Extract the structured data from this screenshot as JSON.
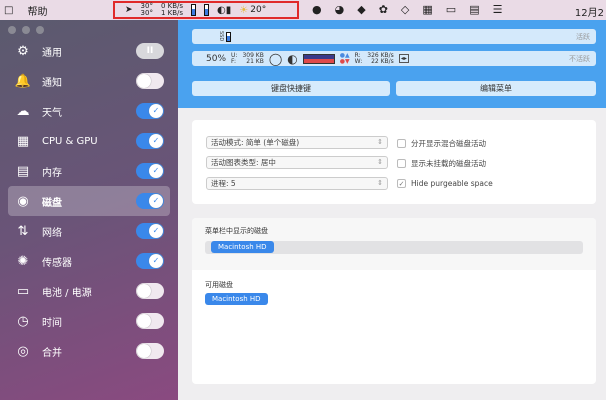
{
  "menubar": {
    "app_icon": "□",
    "help": "帮助",
    "location_temp_top": "30°",
    "location_temp_bottom": "30°",
    "net_up": "0 KB/s",
    "net_down": "1 KB/s",
    "weather": "20°",
    "clock": "12月2"
  },
  "sidebar": {
    "items": [
      {
        "label": "通用",
        "icon": "gear-icon",
        "glyph": "⚙",
        "state": "pause"
      },
      {
        "label": "通知",
        "icon": "bell-icon",
        "glyph": "🔔",
        "state": "off"
      },
      {
        "label": "天气",
        "icon": "cloud-icon",
        "glyph": "☁",
        "state": "on"
      },
      {
        "label": "CPU & GPU",
        "icon": "cpu-icon",
        "glyph": "▦",
        "state": "on"
      },
      {
        "label": "内存",
        "icon": "memory-icon",
        "glyph": "▤",
        "state": "on"
      },
      {
        "label": "磁盘",
        "icon": "disk-icon",
        "glyph": "◉",
        "state": "on",
        "selected": true
      },
      {
        "label": "网络",
        "icon": "network-icon",
        "glyph": "⇅",
        "state": "on"
      },
      {
        "label": "传感器",
        "icon": "sensor-icon",
        "glyph": "✺",
        "state": "on"
      },
      {
        "label": "电池 / 电源",
        "icon": "battery-icon",
        "glyph": "▭",
        "state": "off"
      },
      {
        "label": "时间",
        "icon": "clock-icon",
        "glyph": "◷",
        "state": "off"
      },
      {
        "label": "合并",
        "icon": "combine-icon",
        "glyph": "◎",
        "state": "off"
      }
    ]
  },
  "header": {
    "row1": {
      "label": "SSD",
      "status": "活跃"
    },
    "row2": {
      "percent": "50%",
      "u_label": "U:",
      "u_value": "309 KB",
      "f_label": "F:",
      "f_value": "21 KB",
      "r_label": "R:",
      "r_value": "326 KB/s",
      "w_label": "W:",
      "w_value": "22 KB/s",
      "status": "不活跃"
    },
    "shortcut_button": "键盘快捷键",
    "edit_menu_button": "编辑菜单"
  },
  "options": {
    "activity_mode": "活动模式: 简单 (单个磁盘)",
    "chart_type": "活动图表类型: 居中",
    "processes": "进程:  5",
    "split_label": "分开显示混合磁盘活动",
    "split_checked": false,
    "unmounted_label": "显示未挂载的磁盘活动",
    "unmounted_checked": false,
    "purgeable_label": "Hide purgeable space",
    "purgeable_checked": true
  },
  "disks": {
    "menubar_title": "菜单栏中显示的磁盘",
    "menubar_disk": "Macintosh HD",
    "available_title": "可用磁盘",
    "available_disk": "Macintosh HD"
  },
  "colors": {
    "accent": "#3a88ea",
    "header": "#4aa2ef"
  }
}
